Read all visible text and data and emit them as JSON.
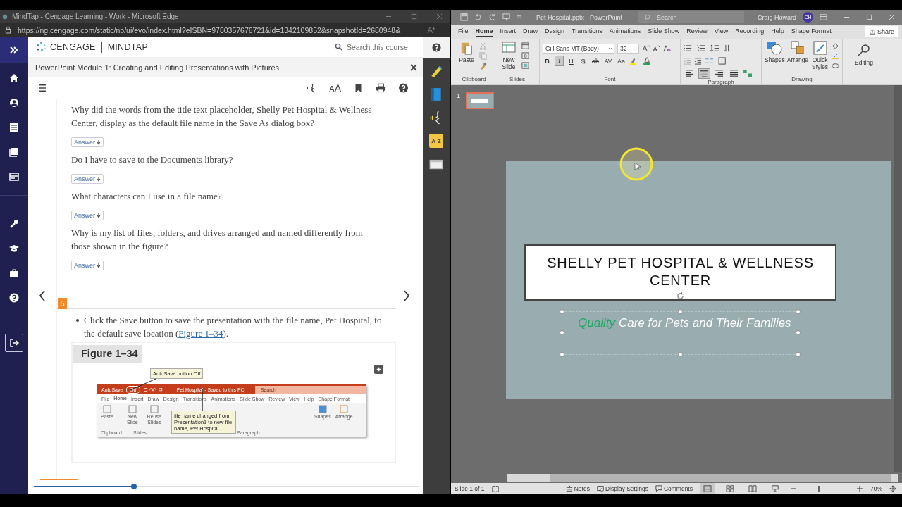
{
  "browser": {
    "title": "MindTap - Cengage Learning - Work - Microsoft Edge",
    "url": "https://ng.cengage.com/static/nb/ui/evo/index.html?eISBN=9780357676721&id=1342109852&snapshotId=2680948&"
  },
  "mindtap": {
    "brand": "CENGAGE",
    "product": "MINDTAP",
    "search": {
      "placeholder": "Search this course"
    },
    "module_title": "PowerPoint Module 1: Creating and Editing Presentations with Pictures",
    "text_size": "AA",
    "questions": [
      {
        "text": "Why did the words from the title text placeholder, Shelly Pet Hospital & Wellness Center, display as the default file name in the Save As dialog box?",
        "button": "Answer"
      },
      {
        "text": "Do I have to save to the Documents library?",
        "button": "Answer"
      },
      {
        "text": "What characters can I use in a file name?",
        "button": "Answer"
      },
      {
        "text": "Why is my list of files, folders, and drives arranged and named differently from those shown in the figure?",
        "button": "Answer"
      }
    ],
    "step": {
      "number": "5",
      "text_before": "Click the Save button to save the presentation with the file name, Pet Hospital, to the default save location (",
      "link": "Figure 1–34",
      "text_after": ")."
    },
    "figure": {
      "title": "Figure 1–34",
      "callouts": [
        "AutoSave button Off",
        "file name changed from Presentation1 to new file name, Pet Hospital"
      ],
      "screenshot": {
        "autosave": "AutoSave",
        "autosave_state": "Off",
        "title": "Pet Hospital - Saved to this PC",
        "search": "Search",
        "tabs": [
          {
            "label": "File",
            "selected": false
          },
          {
            "label": "Home",
            "selected": true
          },
          {
            "label": "Insert",
            "selected": false
          },
          {
            "label": "Draw",
            "selected": false
          },
          {
            "label": "Design",
            "selected": false
          },
          {
            "label": "Transitions",
            "selected": false
          },
          {
            "label": "Animations",
            "selected": false
          },
          {
            "label": "Slide Show",
            "selected": false
          },
          {
            "label": "Review",
            "selected": false
          },
          {
            "label": "View",
            "selected": false
          },
          {
            "label": "Help",
            "selected": false
          },
          {
            "label": "Shape Format",
            "selected": false
          }
        ],
        "buttons": [
          "Paste",
          "New Slide",
          "Reuse Slides",
          "Shapes",
          "Arrange"
        ],
        "groups": [
          "Clipboard",
          "Slides",
          "Paragraph"
        ]
      }
    },
    "reading_progress": {
      "level": 0.26
    }
  },
  "sidetools": {
    "glossary": "A-Z"
  },
  "powerpoint": {
    "title": "Pet Hospital.pptx  -  PowerPoint",
    "search": {
      "placeholder": "Search"
    },
    "user": "Craig Howard",
    "initials": "CH",
    "tabs": [
      {
        "label": "File",
        "selected": false
      },
      {
        "label": "Home",
        "selected": true
      },
      {
        "label": "Insert",
        "selected": false
      },
      {
        "label": "Draw",
        "selected": false
      },
      {
        "label": "Design",
        "selected": false
      },
      {
        "label": "Transitions",
        "selected": false
      },
      {
        "label": "Animations",
        "selected": false
      },
      {
        "label": "Slide Show",
        "selected": false
      },
      {
        "label": "Review",
        "selected": false
      },
      {
        "label": "View",
        "selected": false
      },
      {
        "label": "Recording",
        "selected": false
      },
      {
        "label": "Help",
        "selected": false
      },
      {
        "label": "Shape Format",
        "selected": false
      }
    ],
    "share": "Share",
    "ribbon": {
      "paste": "Paste",
      "new_slide": "New Slide",
      "font_name": "Gill Sans MT (Body)",
      "font_size": "32",
      "format_buttons": [
        {
          "label": "B",
          "pressed": false
        },
        {
          "label": "I",
          "pressed": true
        },
        {
          "label": "U",
          "pressed": false
        },
        {
          "label": "S",
          "pressed": false
        },
        {
          "label": "ab",
          "pressed": false
        },
        {
          "label": "AV",
          "pressed": false
        },
        {
          "label": "Aa",
          "pressed": false
        }
      ],
      "alignment": [
        {
          "kind": "left",
          "selected": false
        },
        {
          "kind": "center",
          "selected": true
        },
        {
          "kind": "right",
          "selected": false
        },
        {
          "kind": "justify",
          "selected": false
        }
      ],
      "drawing_buttons": [
        "Shapes",
        "Arrange",
        "Quick Styles"
      ],
      "editing": "Editing",
      "groups": [
        "Clipboard",
        "Slides",
        "Font",
        "Paragraph",
        "Drawing"
      ]
    },
    "thumbnails": [
      {
        "number": "1",
        "selected": true
      }
    ],
    "slide": {
      "title": "SHELLY PET HOSPITAL & WELLNESS CENTER",
      "subtitle_selected": true,
      "subtitle": [
        {
          "text": "Quality",
          "color": "#22a865"
        },
        {
          "text": "Care for Pets and Their Families",
          "color": "#ffffff"
        }
      ]
    },
    "status": {
      "slide": "Slide 1 of 1",
      "notes": "Notes",
      "display": "Display Settings",
      "comments": "Comments",
      "zoom": "70%",
      "zoom_slider": {
        "level": 0.33
      },
      "views": [
        {
          "kind": "normal",
          "selected": true
        },
        {
          "kind": "sorter",
          "selected": false
        },
        {
          "kind": "reading",
          "selected": false
        },
        {
          "kind": "show",
          "selected": false
        }
      ]
    }
  }
}
